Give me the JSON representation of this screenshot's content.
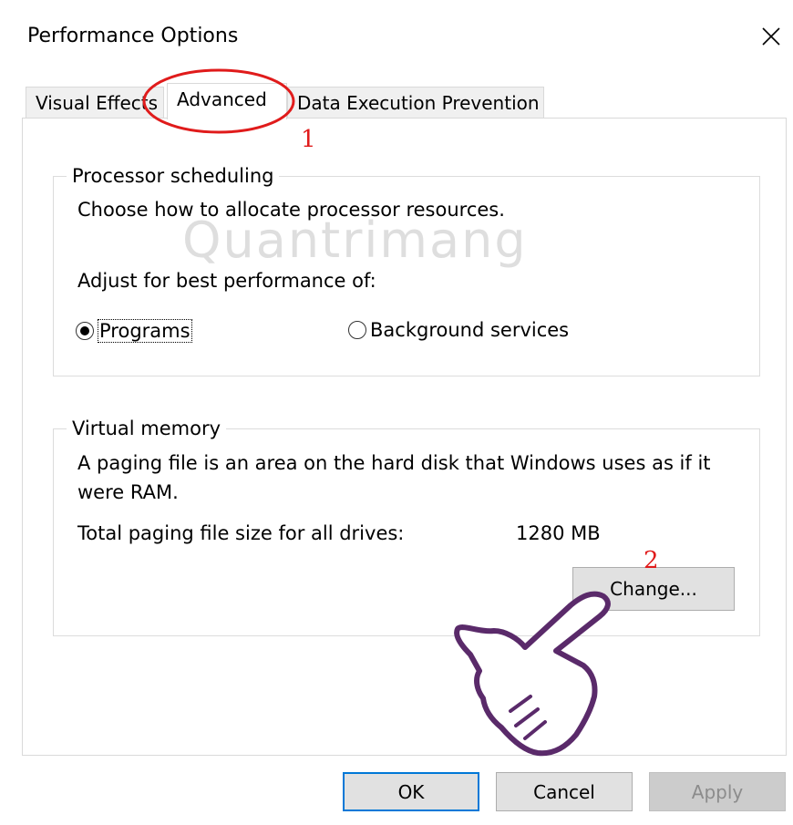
{
  "window": {
    "title": "Performance Options",
    "close_glyph": "✕"
  },
  "tabs": [
    {
      "label": "Visual Effects",
      "active": false
    },
    {
      "label": "Advanced",
      "active": true
    },
    {
      "label": "Data Execution Prevention",
      "active": false
    }
  ],
  "processor_scheduling": {
    "legend": "Processor scheduling",
    "description": "Choose how to allocate processor resources.",
    "adjust_label": "Adjust for best performance of:",
    "options": [
      {
        "label": "Programs",
        "selected": true
      },
      {
        "label": "Background services",
        "selected": false
      }
    ]
  },
  "virtual_memory": {
    "legend": "Virtual memory",
    "description_line1": "A paging file is an area on the hard disk that Windows uses as if it",
    "description_line2": "were RAM.",
    "total_label": "Total paging file size for all drives:",
    "total_value": "1280 MB",
    "change_button": "Change..."
  },
  "footer": {
    "ok": "OK",
    "cancel": "Cancel",
    "apply": "Apply"
  },
  "annotations": {
    "step1": "1",
    "step2": "2",
    "color": "#e01b1b",
    "hand_color": "#5a2a6a"
  },
  "watermark": "Quantrimang",
  "colors": {
    "default_button_border": "#0078d7",
    "button_bg": "#e1e1e1"
  },
  "icons": {
    "close": "close-icon",
    "pointer_hand": "pointing-hand-icon"
  }
}
